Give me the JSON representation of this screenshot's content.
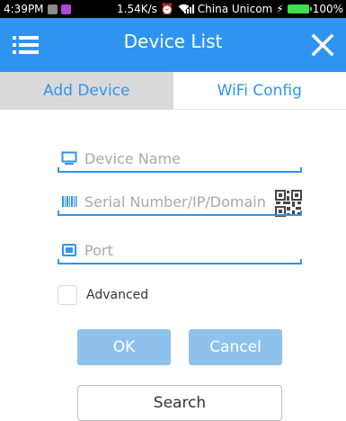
{
  "status_bar": {
    "time": "4:39PM",
    "speed": "1.54K/s",
    "carrier": "China Unicom",
    "battery": "100%"
  },
  "header": {
    "title": "Device List",
    "menu_icon": "menu-icon",
    "close_icon": "close-icon"
  },
  "tabs": [
    {
      "label": "Add Device",
      "active": true
    },
    {
      "label": "WiFi Config",
      "active": false
    }
  ],
  "form": {
    "device_name": {
      "value": "",
      "placeholder": "Device Name",
      "icon": "monitor-icon"
    },
    "serial": {
      "value": "",
      "placeholder": "Serial Number/IP/Domain",
      "icon": "barcode-icon"
    },
    "port": {
      "value": "",
      "placeholder": "Port",
      "icon": "port-icon"
    },
    "qr_icon": "qr-code-icon",
    "advanced_label": "Advanced",
    "advanced_checked": false
  },
  "buttons": {
    "ok": "OK",
    "cancel": "Cancel",
    "search": "Search"
  },
  "colors": {
    "primary": "#2f94f0",
    "button_disabled": "#8ec2ec",
    "tab_active_bg": "#d9d9d9"
  }
}
